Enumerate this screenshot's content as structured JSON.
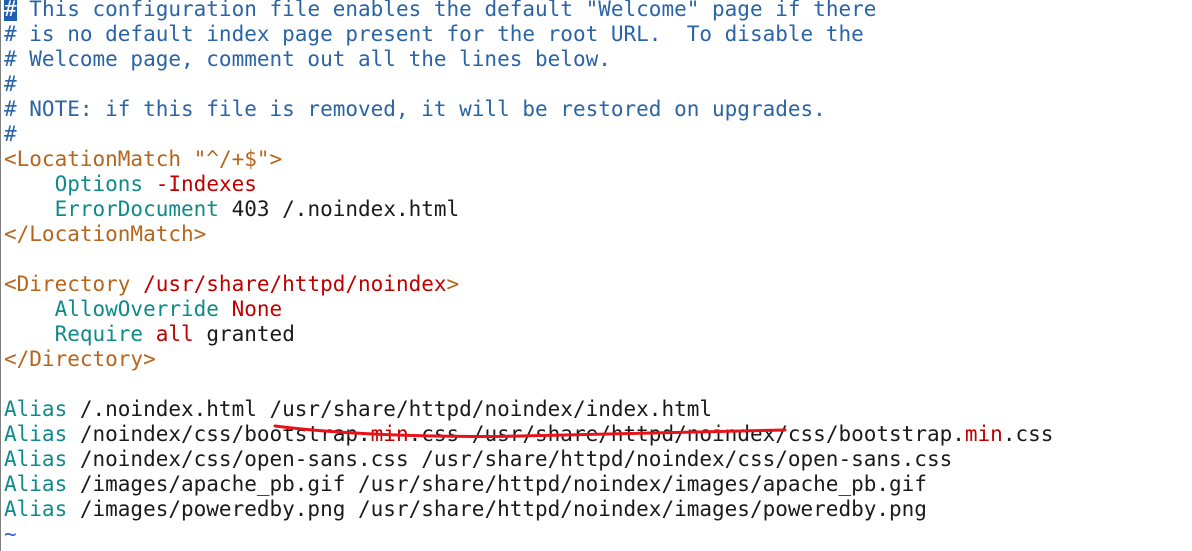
{
  "editor": {
    "lines": [
      {
        "segments": [
          {
            "cls": "cursor-hash",
            "text": "#"
          },
          {
            "cls": "tok-comment",
            "text": " This configuration file enables the default \"Welcome\" page if there"
          }
        ]
      },
      {
        "segments": [
          {
            "cls": "tok-comment",
            "text": "# is no default index page present for the root URL.  To disable the"
          }
        ]
      },
      {
        "segments": [
          {
            "cls": "tok-comment",
            "text": "# Welcome page, comment out all the lines below."
          }
        ]
      },
      {
        "segments": [
          {
            "cls": "tok-comment",
            "text": "#"
          }
        ]
      },
      {
        "segments": [
          {
            "cls": "tok-comment",
            "text": "# NOTE: if this file is removed, it will be restored on upgrades."
          }
        ]
      },
      {
        "segments": [
          {
            "cls": "tok-comment",
            "text": "#"
          }
        ]
      },
      {
        "segments": [
          {
            "cls": "tok-tag",
            "text": "<LocationMatch "
          },
          {
            "cls": "tok-tag",
            "text": "\"^/+$\""
          },
          {
            "cls": "tok-tag",
            "text": ">"
          }
        ]
      },
      {
        "segments": [
          {
            "cls": "tok-plain",
            "text": "    "
          },
          {
            "cls": "tok-dir",
            "text": "Options"
          },
          {
            "cls": "tok-plain",
            "text": " "
          },
          {
            "cls": "tok-val",
            "text": "-Indexes"
          }
        ]
      },
      {
        "segments": [
          {
            "cls": "tok-plain",
            "text": "    "
          },
          {
            "cls": "tok-dir",
            "text": "ErrorDocument"
          },
          {
            "cls": "tok-plain",
            "text": " 403 /.noindex.html"
          }
        ]
      },
      {
        "segments": [
          {
            "cls": "tok-tag",
            "text": "</LocationMatch>"
          }
        ]
      },
      {
        "segments": [
          {
            "cls": "tok-plain",
            "text": ""
          }
        ]
      },
      {
        "segments": [
          {
            "cls": "tok-tag",
            "text": "<Directory "
          },
          {
            "cls": "tok-val",
            "text": "/usr/share/httpd/noindex"
          },
          {
            "cls": "tok-tag",
            "text": ">"
          }
        ]
      },
      {
        "segments": [
          {
            "cls": "tok-plain",
            "text": "    "
          },
          {
            "cls": "tok-dir",
            "text": "AllowOverride"
          },
          {
            "cls": "tok-plain",
            "text": " "
          },
          {
            "cls": "tok-val",
            "text": "None"
          }
        ]
      },
      {
        "segments": [
          {
            "cls": "tok-plain",
            "text": "    "
          },
          {
            "cls": "tok-dir",
            "text": "Require"
          },
          {
            "cls": "tok-plain",
            "text": " "
          },
          {
            "cls": "tok-val",
            "text": "all"
          },
          {
            "cls": "tok-plain",
            "text": " granted"
          }
        ]
      },
      {
        "segments": [
          {
            "cls": "tok-tag",
            "text": "</Directory>"
          }
        ]
      },
      {
        "segments": [
          {
            "cls": "tok-plain",
            "text": ""
          }
        ]
      },
      {
        "segments": [
          {
            "cls": "tok-dir",
            "text": "Alias"
          },
          {
            "cls": "tok-plain",
            "text": " /.noindex.html /usr/share/httpd/noindex/index.html"
          }
        ]
      },
      {
        "segments": [
          {
            "cls": "tok-dir",
            "text": "Alias"
          },
          {
            "cls": "tok-plain",
            "text": " /noindex/css/bootstrap."
          },
          {
            "cls": "tok-val",
            "text": "min"
          },
          {
            "cls": "tok-plain",
            "text": ".css /usr/share/httpd/noindex/css/bootstrap."
          },
          {
            "cls": "tok-val",
            "text": "min"
          },
          {
            "cls": "tok-plain",
            "text": ".css"
          }
        ]
      },
      {
        "segments": [
          {
            "cls": "tok-dir",
            "text": "Alias"
          },
          {
            "cls": "tok-plain",
            "text": " /noindex/css/open-sans.css /usr/share/httpd/noindex/css/open-sans.css"
          }
        ]
      },
      {
        "segments": [
          {
            "cls": "tok-dir",
            "text": "Alias"
          },
          {
            "cls": "tok-plain",
            "text": " /images/apache_pb.gif /usr/share/httpd/noindex/images/apache_pb.gif"
          }
        ]
      },
      {
        "segments": [
          {
            "cls": "tok-dir",
            "text": "Alias"
          },
          {
            "cls": "tok-plain",
            "text": " /images/poweredby.png /usr/share/httpd/noindex/images/poweredby.png"
          }
        ]
      },
      {
        "segments": [
          {
            "cls": "tok-tilde",
            "text": "~"
          }
        ]
      }
    ],
    "colors": {
      "comment": "#2a64a6",
      "tag": "#b5651d",
      "directive": "#0f8a8a",
      "value": "#c00000",
      "annotation": "#e8121a"
    }
  }
}
